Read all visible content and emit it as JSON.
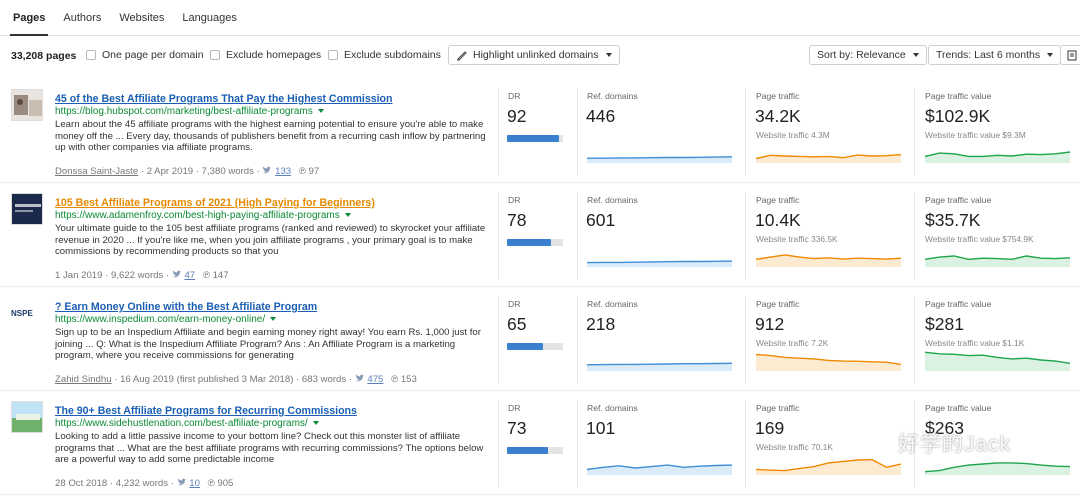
{
  "tabs": [
    {
      "label": "Pages",
      "active": true
    },
    {
      "label": "Authors",
      "active": false
    },
    {
      "label": "Websites",
      "active": false
    },
    {
      "label": "Languages",
      "active": false
    }
  ],
  "toolbar": {
    "count": "33,208 pages",
    "checkboxes": [
      "One page per domain",
      "Exclude homepages",
      "Exclude subdomains"
    ],
    "highlight_label": "Highlight unlinked domains",
    "sort_label": "Sort by: Relevance",
    "trends_label": "Trends: Last 6 months"
  },
  "labels": {
    "dr": "DR",
    "ref_domains": "Ref. domains",
    "page_traffic": "Page traffic",
    "page_traffic_value": "Page traffic value"
  },
  "colors": {
    "title_link": "#1a5fb4",
    "title_link_alt": "#e58a00",
    "url": "#0c8a33",
    "dr_fill": "#3b7fd1",
    "ref_line": "#3d8fd6",
    "traffic_line": "#f08a00",
    "value_line": "#1fa54a"
  },
  "results": [
    {
      "title": "45 of the Best Affiliate Programs That Pay the Highest Commission",
      "title_color": "blue",
      "url": "https://blog.hubspot.com/marketing/best-affiliate-programs",
      "desc": "Learn about the 45 affiliate programs with the highest earning potential to ensure you're able to make money off the ... Every day, thousands of publishers benefit from a recurring cash inflow by partnering up with other companies via affiliate programs.",
      "author": "Donssa Saint-Jaste",
      "meta": " · 2 Apr 2019 · 7,380 words · ",
      "tweets_icon": "twitter-icon",
      "tweets": "133",
      "pins": "97",
      "thumb": "hubspot-thumbnail",
      "dr": "92",
      "dr_fill": 0.92,
      "ref_domains": "446",
      "page_traffic": "34.2K",
      "website_traffic": "Website traffic 4.3M",
      "page_traffic_value": "$102.9K",
      "website_traffic_value": "Website traffic value $9.3M",
      "trend_ref": [
        0.22,
        0.22,
        0.23,
        0.23,
        0.24,
        0.25,
        0.25,
        0.26,
        0.27,
        0.28
      ],
      "trend_traffic": [
        0.2,
        0.35,
        0.32,
        0.3,
        0.28,
        0.3,
        0.24,
        0.36,
        0.32,
        0.33,
        0.38
      ],
      "trend_value": [
        0.3,
        0.45,
        0.42,
        0.3,
        0.3,
        0.35,
        0.32,
        0.4,
        0.38,
        0.42,
        0.5
      ]
    },
    {
      "title": "105 Best Affiliate Programs of 2021 (High Paying for Beginners)",
      "title_color": "orange",
      "url": "https://www.adamenfroy.com/best-high-paying-affiliate-programs",
      "desc": "Your ultimate guide to the 105 best affiliate programs (ranked and reviewed) to skyrocket your affiliate revenue in 2020 ... If you're like me, when you join affiliate programs , your primary goal is to make commissions by recommending products so that you",
      "author": "",
      "meta": "1 Jan 2019 · 9,622 words · ",
      "tweets_icon": "twitter-icon",
      "tweets": "47",
      "pins": "147",
      "thumb": "adamenfroy-thumbnail",
      "dr": "78",
      "dr_fill": 0.78,
      "ref_domains": "601",
      "page_traffic": "10.4K",
      "website_traffic": "Website traffic 336.5K",
      "page_traffic_value": "$35.7K",
      "website_traffic_value": "Website traffic value $754.9K",
      "trend_ref": [
        0.2,
        0.21,
        0.21,
        0.22,
        0.23,
        0.24,
        0.25,
        0.25,
        0.26,
        0.27
      ],
      "trend_traffic": [
        0.35,
        0.45,
        0.55,
        0.45,
        0.38,
        0.42,
        0.36,
        0.4,
        0.38,
        0.36,
        0.4
      ],
      "trend_value": [
        0.35,
        0.45,
        0.5,
        0.35,
        0.4,
        0.38,
        0.35,
        0.5,
        0.4,
        0.38,
        0.42
      ]
    },
    {
      "title": "? Earn Money Online with the Best Affiliate Program",
      "title_color": "blue",
      "url": "https://www.inspedium.com/earn-money-online/",
      "desc": "Sign up to be an Inspedium Affiliate and begin earning money right away! You earn Rs. 1,000 just for joining ... Q: What is the Inspedium Affiliate Program? Ans : An Affiliate Program is a marketing program, where you receive commissions for generating",
      "author": "Zahid Sindhu",
      "meta": " · 16 Aug 2019 (first published 3 Mar 2018) · 683 words · ",
      "tweets_icon": "twitter-icon",
      "tweets": "475",
      "pins": "153",
      "thumb": "inspedium-logo",
      "thumb_text": "NSPE",
      "dr": "65",
      "dr_fill": 0.65,
      "ref_domains": "218",
      "page_traffic": "912",
      "website_traffic": "Website traffic 7.2K",
      "page_traffic_value": "$281",
      "website_traffic_value": "Website traffic value $1.1K",
      "trend_ref": [
        0.28,
        0.29,
        0.3,
        0.3,
        0.31,
        0.32,
        0.33,
        0.33,
        0.34,
        0.35
      ],
      "trend_traffic": [
        0.75,
        0.7,
        0.62,
        0.58,
        0.55,
        0.48,
        0.45,
        0.44,
        0.42,
        0.4,
        0.3
      ],
      "trend_value": [
        0.85,
        0.78,
        0.76,
        0.7,
        0.72,
        0.62,
        0.55,
        0.58,
        0.5,
        0.45,
        0.35
      ]
    },
    {
      "title": "The 90+ Best Affiliate Programs for Recurring Commissions",
      "title_color": "blue",
      "url": "https://www.sidehustlenation.com/best-affiliate-programs/",
      "desc": "Looking to add a little passive income to your bottom line? Check out this monster list of affiliate programs that ... What are the best affiliate programs with recurring commissions? The options below are a powerful way to add some predictable income",
      "author": "",
      "meta": "28 Oct 2018 · 4,232 words · ",
      "tweets_icon": "twitter-icon",
      "tweets": "10",
      "pins": "905",
      "thumb": "sidehustlenation-thumbnail",
      "dr": "73",
      "dr_fill": 0.73,
      "ref_domains": "101",
      "page_traffic": "169",
      "website_traffic": "Website traffic 70.1K",
      "page_traffic_value": "$263",
      "website_traffic_value": "",
      "trend_ref": [
        0.25,
        0.35,
        0.42,
        0.32,
        0.38,
        0.45,
        0.35,
        0.4,
        0.43,
        0.45
      ],
      "trend_traffic": [
        0.25,
        0.22,
        0.2,
        0.3,
        0.38,
        0.55,
        0.62,
        0.68,
        0.7,
        0.35,
        0.5
      ],
      "trend_value": [
        0.15,
        0.2,
        0.35,
        0.45,
        0.5,
        0.55,
        0.55,
        0.52,
        0.45,
        0.4,
        0.38
      ]
    }
  ],
  "watermark": "好学的Jack",
  "watermark_icon": "wechat-icon"
}
